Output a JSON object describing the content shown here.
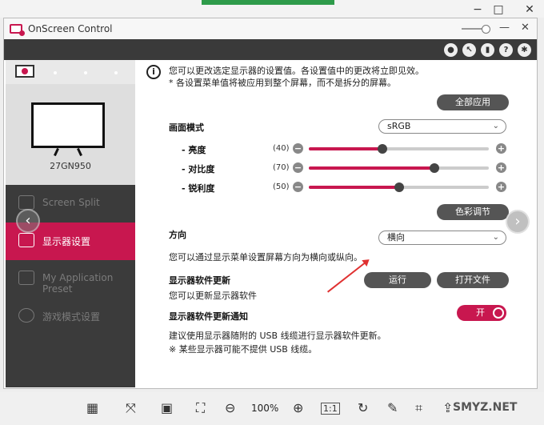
{
  "app": {
    "title": "OnScreen Control",
    "brand_color": "#c8174f"
  },
  "window_controls": {
    "minimize": "−",
    "maximize": "□",
    "close": "✕"
  },
  "app_controls": {
    "minimize": "—",
    "close": "✕"
  },
  "toolbar_icons": [
    "user-icon",
    "cursor-icon",
    "display-icon",
    "help-icon",
    "settings-icon"
  ],
  "toolbar": {
    "help": "?"
  },
  "sidebar": {
    "model": "27GN950",
    "items": [
      {
        "label": "Screen Split",
        "icon": "screen-split-icon",
        "active": false
      },
      {
        "label": "显示器设置",
        "icon": "monitor-settings-icon",
        "active": true
      },
      {
        "label": "My Application Preset",
        "icon": "app-preset-icon",
        "active": false
      },
      {
        "label": "游戏模式设置",
        "icon": "gamepad-icon",
        "active": false
      }
    ]
  },
  "nav": {
    "prev": "‹",
    "next": "›"
  },
  "main": {
    "info_icon": "i",
    "info_line1": "您可以更改选定显示器的设置值。各设置值中的更改将立即见效。",
    "info_line2": "* 各设置菜单值将被应用到整个屏幕，而不是拆分的屏幕。",
    "apply_all": "全部应用",
    "picture_mode_label": "画面模式",
    "picture_mode_value": "sRGB",
    "sliders": [
      {
        "label": "- 亮度",
        "value_text": "(40)",
        "value": 40
      },
      {
        "label": "- 对比度",
        "value_text": "(70)",
        "value": 70
      },
      {
        "label": "- 锐利度",
        "value_text": "(50)",
        "value": 50
      }
    ],
    "color_adjust": "色彩调节",
    "orientation_label": "方向",
    "orientation_value": "横向",
    "orientation_desc": "您可以通过显示菜单设置屏幕方向为横向或纵向。",
    "fw_update_label": "显示器软件更新",
    "fw_update_desc": "您可以更新显示器软件",
    "run_button": "运行",
    "open_file_button": "打开文件",
    "fw_notify_label": "显示器软件更新通知",
    "toggle_label": "开",
    "toggle_on": true,
    "notice1": "建议使用显示器随附的 USB 线缆进行显示器软件更新。",
    "notice2": "※ 某些显示器可能不提供 USB 线缆。"
  },
  "viewer": {
    "zoom": "100%",
    "one_to_one": "1:1",
    "watermark": "SMYZ.NET",
    "icons": [
      "layout-icon",
      "fit-icon",
      "ocr-icon",
      "crop-frame-icon",
      "zoom-out-icon",
      "zoom-in-icon",
      "actual-size-icon",
      "rotate-icon",
      "edit-icon",
      "crop-icon",
      "share-icon"
    ]
  }
}
